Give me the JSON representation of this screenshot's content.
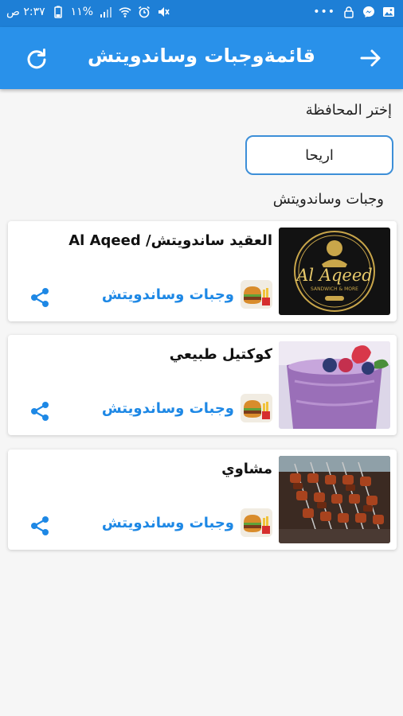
{
  "status": {
    "time": "٢:٣٧ ص",
    "battery": "١١%"
  },
  "app_bar": {
    "title": "قائمةوجبات وساندويتش"
  },
  "filter": {
    "label": "إختر المحافظة",
    "selected": "اريحا"
  },
  "section": {
    "title": "وجبات وساندويتش"
  },
  "items": [
    {
      "name": "العقيد ساندويتش/ Al Aqeed",
      "category": "وجبات وساندويتش",
      "logo_text": "Al Aqeed",
      "logo_sub": "SANDWICH & MORE"
    },
    {
      "name": "كوكتيل طبيعي",
      "category": "وجبات وساندويتش"
    },
    {
      "name": "مشاوي",
      "category": "وجبات وساندويتش"
    }
  ]
}
